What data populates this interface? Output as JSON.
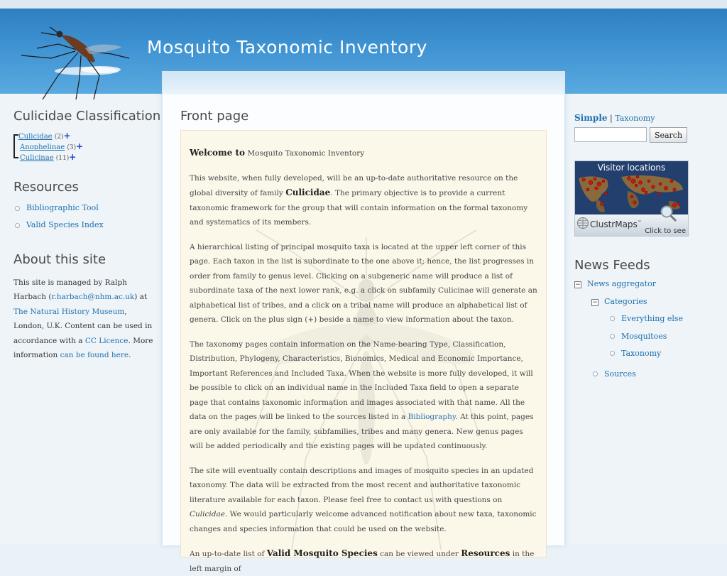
{
  "site": {
    "name": "Mosquito Taxonomic Inventory"
  },
  "left": {
    "classification_title": "Culicidae Classification",
    "classification": [
      {
        "name": "Culicidae",
        "count": "(2)"
      },
      {
        "name": "Anophelinae",
        "count": "(3)"
      },
      {
        "name": "Culicinae",
        "count": "(11)"
      }
    ],
    "resources_title": "Resources",
    "resources": [
      "Bibliographic Tool",
      "Valid Species Index"
    ],
    "about_title": "About this site",
    "about": {
      "t1": "This site is managed by Ralph Harbach (",
      "email": "r.harbach@nhm.ac.uk",
      "t2": ") at ",
      "museum": "The Natural History Museum",
      "t3": ", London, U.K. Content can be used in accordance with a ",
      "cc": "CC Licence",
      "t4": ". More information ",
      "found": "can be found here",
      "t5": "."
    }
  },
  "main": {
    "page_title": "Front page",
    "p1_bold": "Welcome to",
    "p1_rest": " Mosquito Taxonomic Inventory",
    "p2_a": "This website, when fully developed, will be an up-to-date authoritative resource on the global diversity of family ",
    "p2_bold": "Culicidae",
    "p2_b": ". The primary objective is to provide a current taxonomic framework for the group that will contain information on the formal taxonomy and systematics of its members.",
    "p3": "A hierarchical listing of principal mosquito taxa is located at the upper left corner of this page. Each taxon in the list is subordinate to the one above it; hence, the list progresses in order from family to genus level. Clicking on a subgeneric name will produce a list of subordinate taxa of the next lower rank, e.g. a click on subfamily Culicinae will generate an alphabetical list of tribes, and a click on a tribal name will produce an alphabetical list of genera. Click on the plus sign (+) beside a name to view information about the taxon.",
    "p4_a": "The taxonomy pages contain information on the Name-bearing Type, Classification, Distribution, Phylogeny, Characteristics, Bionomics, Medical and Economic Importance, Important References and Included Taxa. When the website is more fully developed, it will be possible to click on an individual name in the Included Taxa field to open a separate page that contains taxonomic information and images associated with that name. All the data on the pages will be linked to the sources listed in a ",
    "p4_link": "Bibliography",
    "p4_b": ". At this point, pages are only available for the family, subfamilies, tribes and many genera. New genus pages will be added periodically and the existing pages will be updated continuously.",
    "p5_a": "The site will eventually contain descriptions and images of mosquito species in an updated taxonomy. The data will be extracted from the most recent and authoritative taxonomic literature available for each taxon. Please feel free to contact us with questions on ",
    "p5_italic": "Culicidae",
    "p5_b": ". We would particularly welcome advanced notification about new taxa, taxonomic changes and species information that could be used on the website.",
    "p6_a": "An up-to-date list of ",
    "p6_bold1": "Valid Mosquito Species",
    "p6_b": " can be viewed under ",
    "p6_bold2": "Resources",
    "p6_c": " in the left margin of"
  },
  "right": {
    "simple": "Simple",
    "sep": "|",
    "taxonomy": "Taxonomy",
    "search_button": "Search",
    "map_title": "Visitor locations",
    "map_brand": "ClustrMaps",
    "map_tm": "™",
    "map_click": "Click to see",
    "news_title": "News Feeds",
    "news": {
      "aggregator": "News aggregator",
      "categories": "Categories",
      "everything": "Everything else",
      "mosquitoes": "Mosquitoes",
      "taxonomy": "Taxonomy",
      "sources": "Sources",
      "minus": "−"
    }
  },
  "colors": {
    "header": "#3f93d2",
    "link": "#1f6fae",
    "content_bg": "#fbf7e9"
  }
}
